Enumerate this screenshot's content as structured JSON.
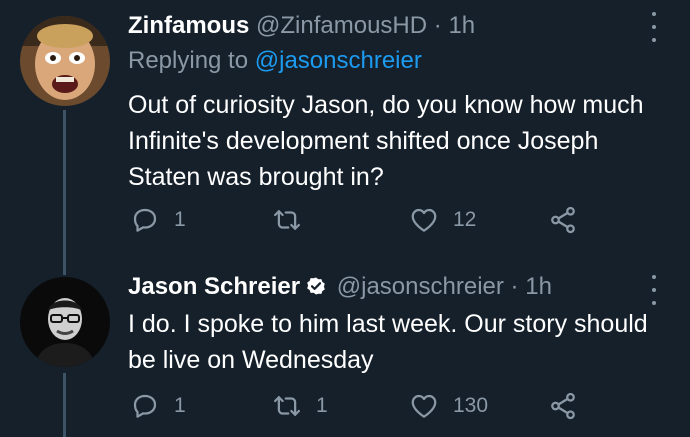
{
  "tweets": [
    {
      "display_name": "Zinfamous",
      "handle": "@ZinfamousHD",
      "separator": "·",
      "time": "1h",
      "replying_prefix": "Replying to",
      "replying_to": "@jasonschreier",
      "text": "Out of curiosity Jason, do you know how much Infinite's development shifted once Joseph Staten was brought in?",
      "replies": "1",
      "retweets": "",
      "likes": "12",
      "verified": false
    },
    {
      "display_name": "Jason Schreier",
      "handle": "@jasonschreier",
      "separator": "·",
      "time": "1h",
      "text": "I do. I spoke to him last week. Our story should be live on Wednesday",
      "replies": "1",
      "retweets": "1",
      "likes": "130",
      "verified": true
    }
  ],
  "colors": {
    "background": "#15202b",
    "text": "#ffffff",
    "muted": "#8b98a5",
    "link": "#1d9bf0",
    "thread_line": "#3d5466"
  },
  "icons": [
    "reply-icon",
    "retweet-icon",
    "like-icon",
    "share-icon",
    "more-icon",
    "verified-icon"
  ]
}
